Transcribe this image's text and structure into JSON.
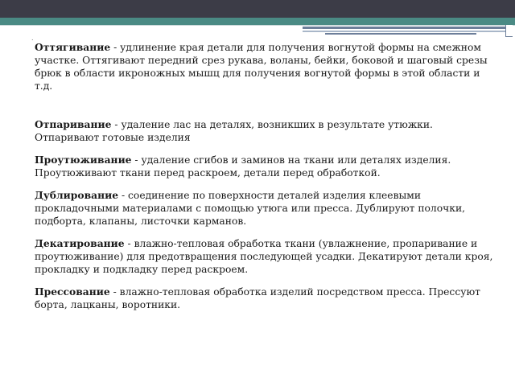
{
  "slide": {
    "marker": ".",
    "paragraphs": [
      {
        "term": "Оттягивание",
        "text": " - удлинение края детали для получения вогнутой формы на смежном участке. Оттягивают передний срез рукава, воланы, бейки, боковой и шаговый срезы брюк в области икроножных мышц для получения вогнутой формы в этой области и т.д."
      },
      {
        "term": "Отпаривание",
        "text": " - удаление лас на деталях, возникших в результате утюжки. Отпаривают готовые изделия"
      },
      {
        "term": "Проутюживание",
        "text": " - удаление сгибов и заминов на ткани или деталях изделия. Проутюживают ткани перед раскроем, детали перед обработкой."
      },
      {
        "term": "Дублирование",
        "text": " - соединение по поверхности деталей изделия клеевыми прокладочными материалами с помощью утюга или пресса. Дублируют полочки, подборта, клапаны, листочки карманов."
      },
      {
        "term": "Декатирование",
        "text": " - влажно-тепловая обработка ткани (увлажнение, пропаривание и проутюживание) для предотвращения последующей усадки. Декатируют детали кроя, прокладку и подкладку перед раскроем."
      },
      {
        "term": "Прессование",
        "text": " - влажно-тепловая обработка изделий посредством пресса. Прессуют борта, лацканы, воротники."
      }
    ]
  },
  "colors": {
    "header_dark": "#3c3c47",
    "header_teal": "#4a8a84",
    "stripe": "#6d7f9a",
    "text": "#1a1a1a"
  }
}
